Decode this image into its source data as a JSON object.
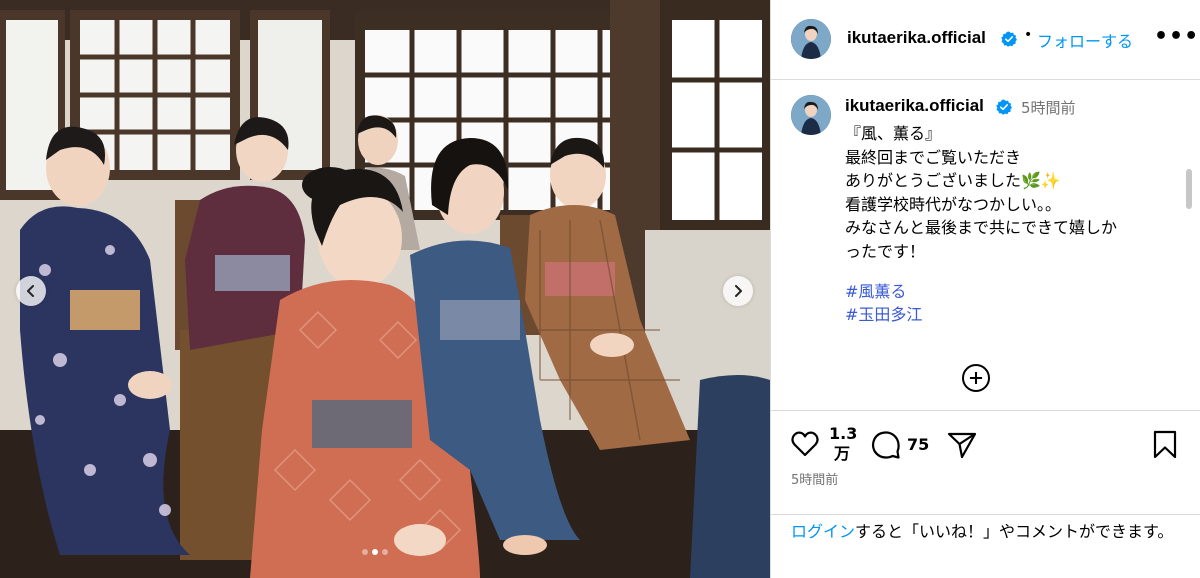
{
  "post": {
    "username": "ikutaerika.official",
    "follow_label": "フォローする",
    "separator": "•",
    "more_label": "•••",
    "time_ago": "5時間前",
    "caption_lines": [
      "『風、薫る』",
      "最終回までご覧いただき",
      "ありがとうございました🌿✨",
      "看護学校時代がなつかしい。。",
      "みなさんと最後まで共にできて嬉しか",
      "ったです！"
    ],
    "hashtags": [
      "#風薫る",
      "#玉田多江"
    ],
    "likes": {
      "num": "1.3",
      "unit": "万"
    },
    "comments": "75",
    "timestamp": "5時間前",
    "login": {
      "link": "ログイン",
      "rest": "すると「いいね！」やコメントができます。"
    }
  },
  "carousel": {
    "total": 3,
    "active_index": 1
  },
  "icons": {
    "verified": "verified-badge-icon",
    "prev": "chevron-left-icon",
    "next": "chevron-right-icon",
    "load_more": "plus-circle-icon",
    "like": "heart-icon",
    "comment": "comment-icon",
    "share": "paper-plane-icon",
    "save": "bookmark-icon"
  },
  "colors": {
    "link": "#0095f6",
    "hashtag": "#3b5bd6",
    "verified": "#0095f6",
    "muted": "#737373",
    "border": "#dbdbdb"
  }
}
